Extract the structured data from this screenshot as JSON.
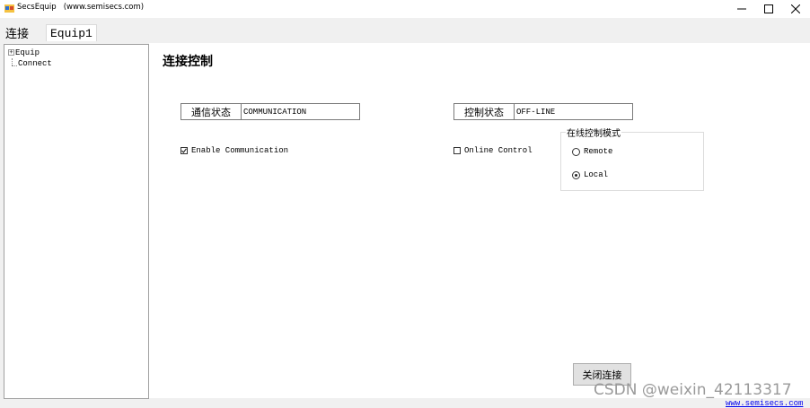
{
  "window": {
    "title": "SecsEquip   (www.semisecs.com)",
    "minimize_glyph": "–",
    "maximize_glyph": "☐",
    "close_glyph": "✕"
  },
  "tabs": [
    {
      "label": "连接",
      "active": false
    },
    {
      "label": "Equip1",
      "active": true
    }
  ],
  "tree": {
    "items": [
      {
        "label": "Equip",
        "expander": "+"
      },
      {
        "label": "Connect"
      }
    ]
  },
  "main": {
    "title": "连接控制",
    "comm_state": {
      "label": "通信状态",
      "value": "COMMUNICATION"
    },
    "enable_comm": {
      "label": "Enable Communication",
      "checked": true
    },
    "control_state": {
      "label": "控制状态",
      "value": "OFF-LINE"
    },
    "online_control": {
      "label": "Online Control",
      "checked": false
    },
    "online_mode_group": {
      "legend": "在线控制模式",
      "options": [
        {
          "label": "Remote",
          "selected": false
        },
        {
          "label": "Local",
          "selected": true
        }
      ]
    },
    "close_button": "关闭连接"
  },
  "watermark": "CSDN @weixin_42113317",
  "footer_link": "www.semisecs.com"
}
